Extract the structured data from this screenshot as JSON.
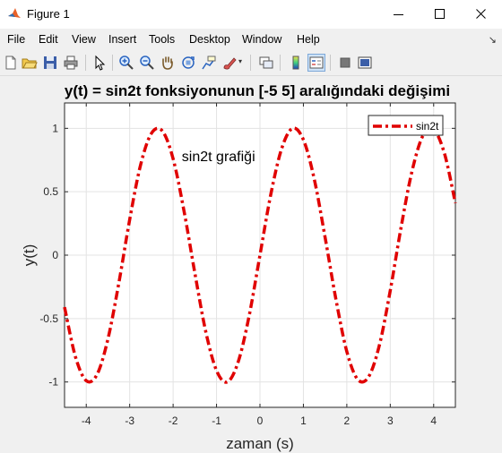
{
  "window": {
    "title": "Figure 1"
  },
  "menu": {
    "items": [
      "File",
      "Edit",
      "View",
      "Insert",
      "Tools",
      "Desktop",
      "Window",
      "Help"
    ]
  },
  "toolbar": {
    "buttons": [
      "new-figure",
      "open-file",
      "save",
      "print",
      "edit-plot-arrow",
      "zoom-in",
      "zoom-out",
      "pan",
      "rotate-3d",
      "data-cursor",
      "brush",
      "link-plot",
      "colorbar",
      "legend",
      "hide-plot-tools",
      "show-plot-tools"
    ]
  },
  "chart_data": {
    "type": "line",
    "title": "y(t) = sin2t fonksiyonunun [-5 5] aralığındaki değişimi",
    "xlabel": "zaman (s)",
    "ylabel": "y(t)",
    "xlim": [
      -4.5,
      4.5
    ],
    "ylim": [
      -1.2,
      1.2
    ],
    "xticks": [
      -4,
      -3,
      -2,
      -1,
      0,
      1,
      2,
      3,
      4
    ],
    "yticks": [
      -1,
      -0.5,
      0,
      0.5,
      1
    ],
    "xtick_labels": [
      "-4",
      "-3",
      "-2",
      "-1",
      "0",
      "1",
      "2",
      "3",
      "4"
    ],
    "ytick_labels": [
      "-1",
      "-0.5",
      "0",
      "0.5",
      "1"
    ],
    "grid": true,
    "legend_position": "top-right",
    "annotation": {
      "text": "sin2t grafiği",
      "x": -1.8,
      "y": 0.74
    },
    "series": [
      {
        "name": "sin2t",
        "color": "#e00000",
        "line_style": "dash-dot",
        "x": [
          -4.5,
          -4.25,
          -4.0,
          -3.75,
          -3.5,
          -3.25,
          -3.0,
          -2.75,
          -2.5,
          -2.25,
          -2.0,
          -1.75,
          -1.5,
          -1.25,
          -1.0,
          -0.75,
          -0.5,
          -0.25,
          0.0,
          0.25,
          0.5,
          0.75,
          1.0,
          1.25,
          1.5,
          1.75,
          2.0,
          2.25,
          2.5,
          2.75,
          3.0,
          3.25,
          3.5,
          3.75,
          4.0,
          4.25,
          4.5
        ],
        "y": [
          -0.41,
          -0.8,
          -0.99,
          -0.94,
          -0.66,
          -0.22,
          0.28,
          0.71,
          0.96,
          0.98,
          0.76,
          0.35,
          -0.14,
          -0.6,
          -0.91,
          -1.0,
          -0.84,
          -0.48,
          0.0,
          0.48,
          0.84,
          1.0,
          0.91,
          0.6,
          0.14,
          -0.35,
          -0.76,
          -0.98,
          -0.96,
          -0.71,
          -0.28,
          0.22,
          0.66,
          0.94,
          0.99,
          0.8,
          0.41
        ]
      }
    ]
  }
}
